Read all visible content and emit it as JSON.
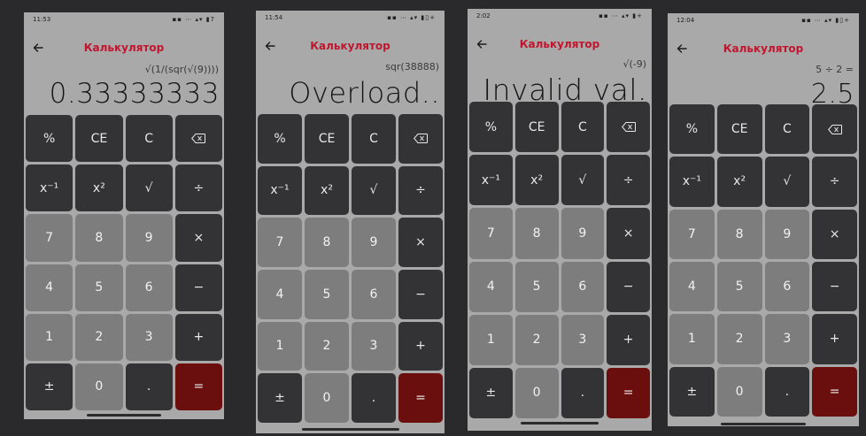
{
  "app": {
    "title": "Калькулятор"
  },
  "keys": [
    {
      "label": "%",
      "type": "fn",
      "name": "percent-key"
    },
    {
      "label": "CE",
      "type": "fn",
      "name": "clear-entry-key"
    },
    {
      "label": "C",
      "type": "fn",
      "name": "clear-key"
    },
    {
      "label": "",
      "type": "fn",
      "name": "backspace-key",
      "icon": "backspace-icon"
    },
    {
      "label": "x⁻¹",
      "type": "fn",
      "name": "reciprocal-key"
    },
    {
      "label": "x²",
      "type": "fn",
      "name": "square-key"
    },
    {
      "label": "√",
      "type": "fn",
      "name": "sqrt-key"
    },
    {
      "label": "÷",
      "type": "fn",
      "name": "divide-key"
    },
    {
      "label": "7",
      "type": "num",
      "name": "digit-7-key"
    },
    {
      "label": "8",
      "type": "num",
      "name": "digit-8-key"
    },
    {
      "label": "9",
      "type": "num",
      "name": "digit-9-key"
    },
    {
      "label": "×",
      "type": "fn",
      "name": "multiply-key"
    },
    {
      "label": "4",
      "type": "num",
      "name": "digit-4-key"
    },
    {
      "label": "5",
      "type": "num",
      "name": "digit-5-key"
    },
    {
      "label": "6",
      "type": "num",
      "name": "digit-6-key"
    },
    {
      "label": "−",
      "type": "fn",
      "name": "minus-key"
    },
    {
      "label": "1",
      "type": "num",
      "name": "digit-1-key"
    },
    {
      "label": "2",
      "type": "num",
      "name": "digit-2-key"
    },
    {
      "label": "3",
      "type": "num",
      "name": "digit-3-key"
    },
    {
      "label": "+",
      "type": "fn",
      "name": "plus-key"
    },
    {
      "label": "±",
      "type": "fn",
      "name": "negate-key"
    },
    {
      "label": "0",
      "type": "num",
      "name": "digit-0-key"
    },
    {
      "label": ".",
      "type": "fn",
      "name": "decimal-key"
    },
    {
      "label": "=",
      "type": "eq",
      "name": "equals-key"
    }
  ],
  "screens": [
    {
      "time": "11:53",
      "status_icons": "▪▪ ⋯ ▴▾ ▮7",
      "expression": "√(1/(sqr(√(9))))",
      "result": "0.33333333"
    },
    {
      "time": "11:54",
      "status_icons": "▪▪ ⋯ ▴▾ ▮▯+",
      "expression": "sqr(38888)",
      "result": "Overload.."
    },
    {
      "time": "2:02",
      "status_icons": "▪▪ ⋯ ▴▾ ▮+",
      "expression": "√(-9)",
      "result": "Invalid val."
    },
    {
      "time": "12:04",
      "status_icons": "▪▪ ⋯ ▴▾ ▮▯+",
      "expression": "5 ÷ 2 =",
      "result": "2.5"
    }
  ],
  "colors": {
    "background": "#a9a9a9",
    "function_key": "#333335",
    "number_key": "#7d7d7d",
    "equals_key": "#6b0e0e",
    "title": "#c2152e"
  }
}
